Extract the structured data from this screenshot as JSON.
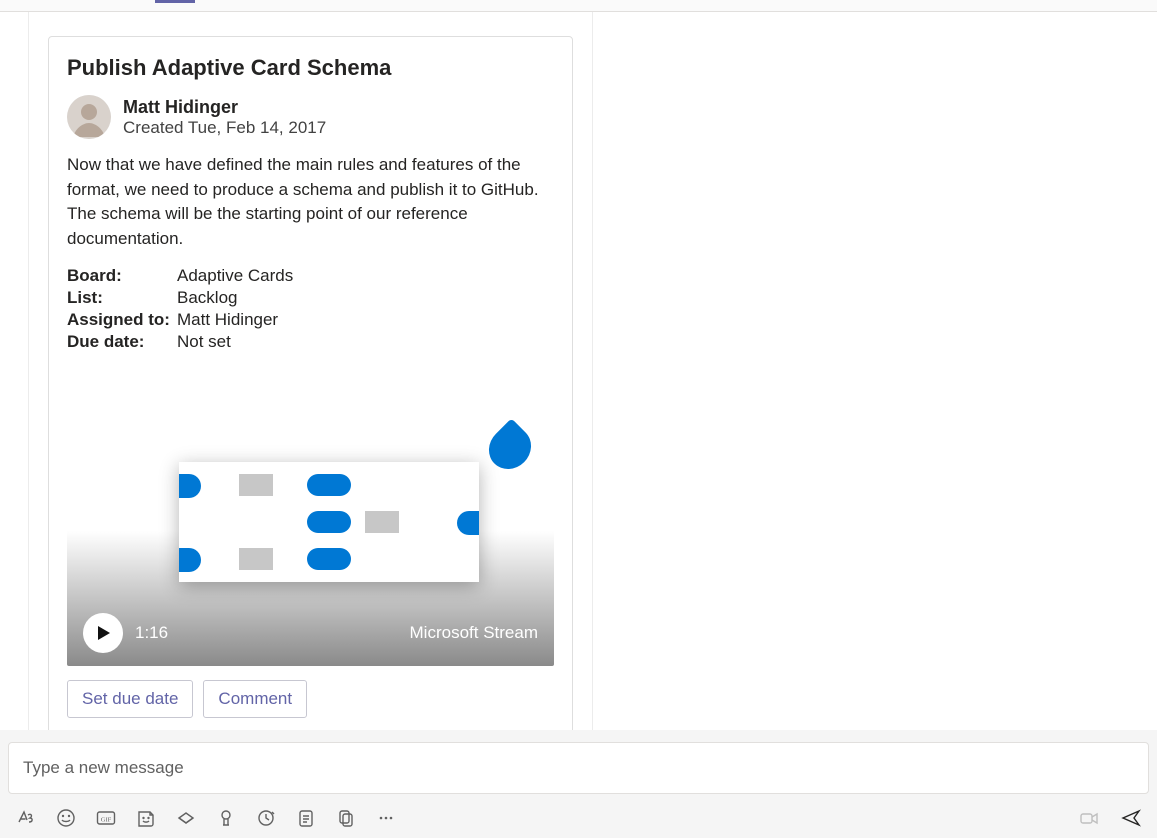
{
  "card": {
    "title": "Publish Adaptive Card Schema",
    "author": {
      "name": "Matt Hidinger",
      "created": "Created Tue, Feb 14, 2017"
    },
    "body": "Now that we have defined the main rules and features of the format, we need to produce a schema and publish it to GitHub. The schema will be the starting point of our reference documentation.",
    "facts": {
      "board_k": "Board:",
      "board_v": "Adaptive Cards",
      "list_k": "List:",
      "list_v": "Backlog",
      "assigned_k": "Assigned to:",
      "assigned_v": "Matt Hidinger",
      "due_k": "Due date:",
      "due_v": "Not set"
    },
    "media": {
      "duration": "1:16",
      "source": "Microsoft Stream"
    },
    "actions": {
      "set_due": "Set due date",
      "comment": "Comment"
    }
  },
  "compose": {
    "placeholder": "Type a new message"
  },
  "colors": {
    "accent": "#6264A7",
    "ms_blue": "#0078D4"
  }
}
